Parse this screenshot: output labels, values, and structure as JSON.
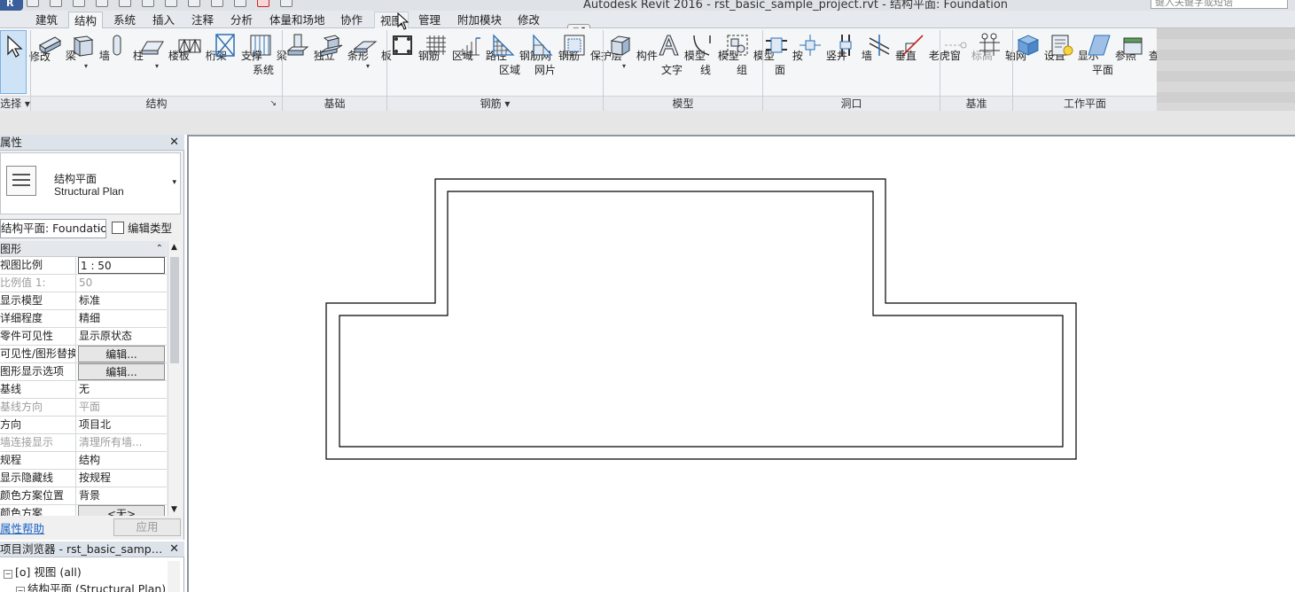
{
  "titlebar": {
    "app_letter": "R",
    "title": "Autodesk Revit 2016  -  rst_basic_sample_project.rvt - 结构平面: Foundation",
    "search_placeholder": "键入关键字或短语"
  },
  "tabs": [
    "建筑",
    "结构",
    "系统",
    "插入",
    "注释",
    "分析",
    "体量和场地",
    "协作",
    "视图",
    "管理",
    "附加模块",
    "修改"
  ],
  "active_tab": "结构",
  "ribbon": {
    "panels": {
      "select": "选择",
      "structure": "结构",
      "foundation": "基础",
      "rebar": "钢筋",
      "model": "模型",
      "opening": "洞口",
      "datum": "基准",
      "workplane": "工作平面"
    },
    "buttons": {
      "modify": "修改",
      "beam": "梁",
      "wall": "墙",
      "column": "柱",
      "floor": "楼板",
      "truss": "桁架",
      "brace": "支撑",
      "beam_system_1": "梁",
      "beam_system_2": "系统",
      "isolated": "独立",
      "strip": "条形",
      "slab": "板",
      "rebar": "钢筋",
      "area": "区域",
      "path": "路径",
      "fabric_area_1": "钢筋网",
      "fabric_area_2": "区域",
      "fabric_sheet_1": "钢筋",
      "fabric_sheet_2": "网片",
      "cover": "保护层",
      "component": "构件",
      "model_text_1": "模型",
      "model_text_2": "文字",
      "model_line_1": "模型",
      "model_line_2": "线",
      "model_group_1": "模型",
      "model_group_2": "组",
      "by_face_1": "按",
      "by_face_2": "面",
      "shaft": "竖井",
      "wall_opening": "墙",
      "vertical": "垂直",
      "dormer": "老虎窗",
      "level": "标高",
      "grid": "轴网",
      "set": "设置",
      "show": "显示",
      "ref_plane_1": "参照",
      "ref_plane_2": "平面",
      "viewer": "查看器"
    }
  },
  "properties": {
    "header": "属性",
    "type_line1": "结构平面",
    "type_line2": "Structural Plan",
    "instance": "结构平面: Foundation",
    "edit_type": "编辑类型",
    "group": "图形",
    "rows": [
      {
        "k": "视图比例",
        "v": "1 : 50"
      },
      {
        "k": "比例值 1:",
        "v": "50"
      },
      {
        "k": "显示模型",
        "v": "标准"
      },
      {
        "k": "详细程度",
        "v": "精细"
      },
      {
        "k": "零件可见性",
        "v": "显示原状态"
      },
      {
        "k": "可见性/图形替换",
        "v": "编辑..."
      },
      {
        "k": "图形显示选项",
        "v": "编辑..."
      },
      {
        "k": "基线",
        "v": "无"
      },
      {
        "k": "基线方向",
        "v": "平面"
      },
      {
        "k": "方向",
        "v": "项目北"
      },
      {
        "k": "墙连接显示",
        "v": "清理所有墙..."
      },
      {
        "k": "规程",
        "v": "结构"
      },
      {
        "k": "显示隐藏线",
        "v": "按规程"
      },
      {
        "k": "颜色方案位置",
        "v": "背景"
      },
      {
        "k": "颜色方案",
        "v": "<无>"
      }
    ],
    "help": "属性帮助",
    "apply": "应用"
  },
  "browser": {
    "header": "项目浏览器 - rst_basic_sample_project.rvt",
    "node_views": "视图 (all)",
    "node_structural": "结构平面 (Structural Plan)"
  },
  "colors": {
    "accent": "#3b5f9a",
    "ribbon_bg": "#f5f6f7",
    "tab_bg": "#e6e9ed",
    "link": "#1a62c4",
    "outline": "#000000"
  }
}
